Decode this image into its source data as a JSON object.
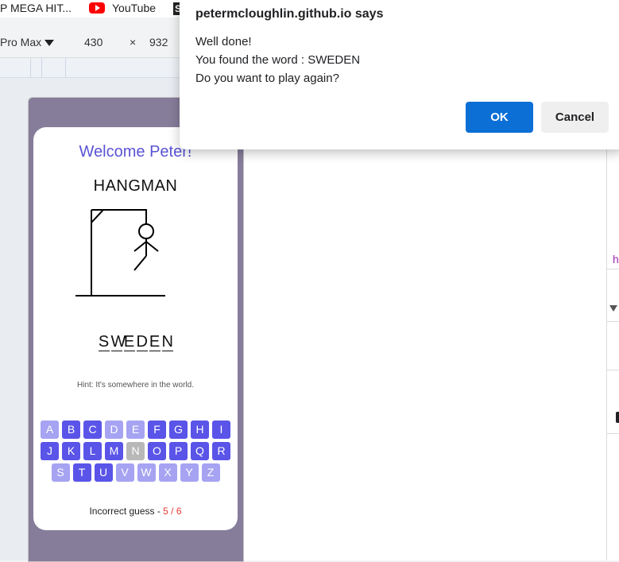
{
  "bookmarks": {
    "item1": "P MEGA HIT...",
    "item2": "YouTube",
    "item3_favicon": "S"
  },
  "devtools": {
    "device": "Pro Max",
    "width": "430",
    "times": "×",
    "height": "932",
    "right_panel_text": "h"
  },
  "dialog": {
    "title": "petermcloughlin.github.io says",
    "line1": "Well done!",
    "line2": "You found the word : SWEDEN",
    "line3": "Do you want to play again?",
    "ok": "OK",
    "cancel": "Cancel"
  },
  "game": {
    "welcome": "Welcome Peter!",
    "title": "HANGMAN",
    "word": [
      "S",
      "W",
      "E",
      "D",
      "E",
      "N"
    ],
    "hint": "Hint: It's somewhere in the world.",
    "incorrect_label": "Incorrect guess - ",
    "incorrect_count": "5 / 6",
    "keyboard": [
      [
        {
          "l": "A",
          "s": "used"
        },
        {
          "l": "B",
          "s": "active"
        },
        {
          "l": "C",
          "s": "active"
        },
        {
          "l": "D",
          "s": "used"
        },
        {
          "l": "E",
          "s": "used"
        },
        {
          "l": "F",
          "s": "active"
        },
        {
          "l": "G",
          "s": "active"
        },
        {
          "l": "H",
          "s": "active"
        },
        {
          "l": "I",
          "s": "active"
        }
      ],
      [
        {
          "l": "J",
          "s": "active"
        },
        {
          "l": "K",
          "s": "active"
        },
        {
          "l": "L",
          "s": "active"
        },
        {
          "l": "M",
          "s": "active"
        },
        {
          "l": "N",
          "s": "wrong"
        },
        {
          "l": "O",
          "s": "active"
        },
        {
          "l": "P",
          "s": "active"
        },
        {
          "l": "Q",
          "s": "active"
        },
        {
          "l": "R",
          "s": "active"
        }
      ],
      [
        {
          "l": "S",
          "s": "used"
        },
        {
          "l": "T",
          "s": "active"
        },
        {
          "l": "U",
          "s": "active"
        },
        {
          "l": "V",
          "s": "used"
        },
        {
          "l": "W",
          "s": "used"
        },
        {
          "l": "X",
          "s": "used"
        },
        {
          "l": "Y",
          "s": "used"
        },
        {
          "l": "Z",
          "s": "used"
        }
      ]
    ]
  },
  "colors": {
    "accent": "#5a54e8",
    "ok_button": "#0b6fd6",
    "phone_frame": "#867d9a",
    "incorrect_count": "#e53935"
  }
}
